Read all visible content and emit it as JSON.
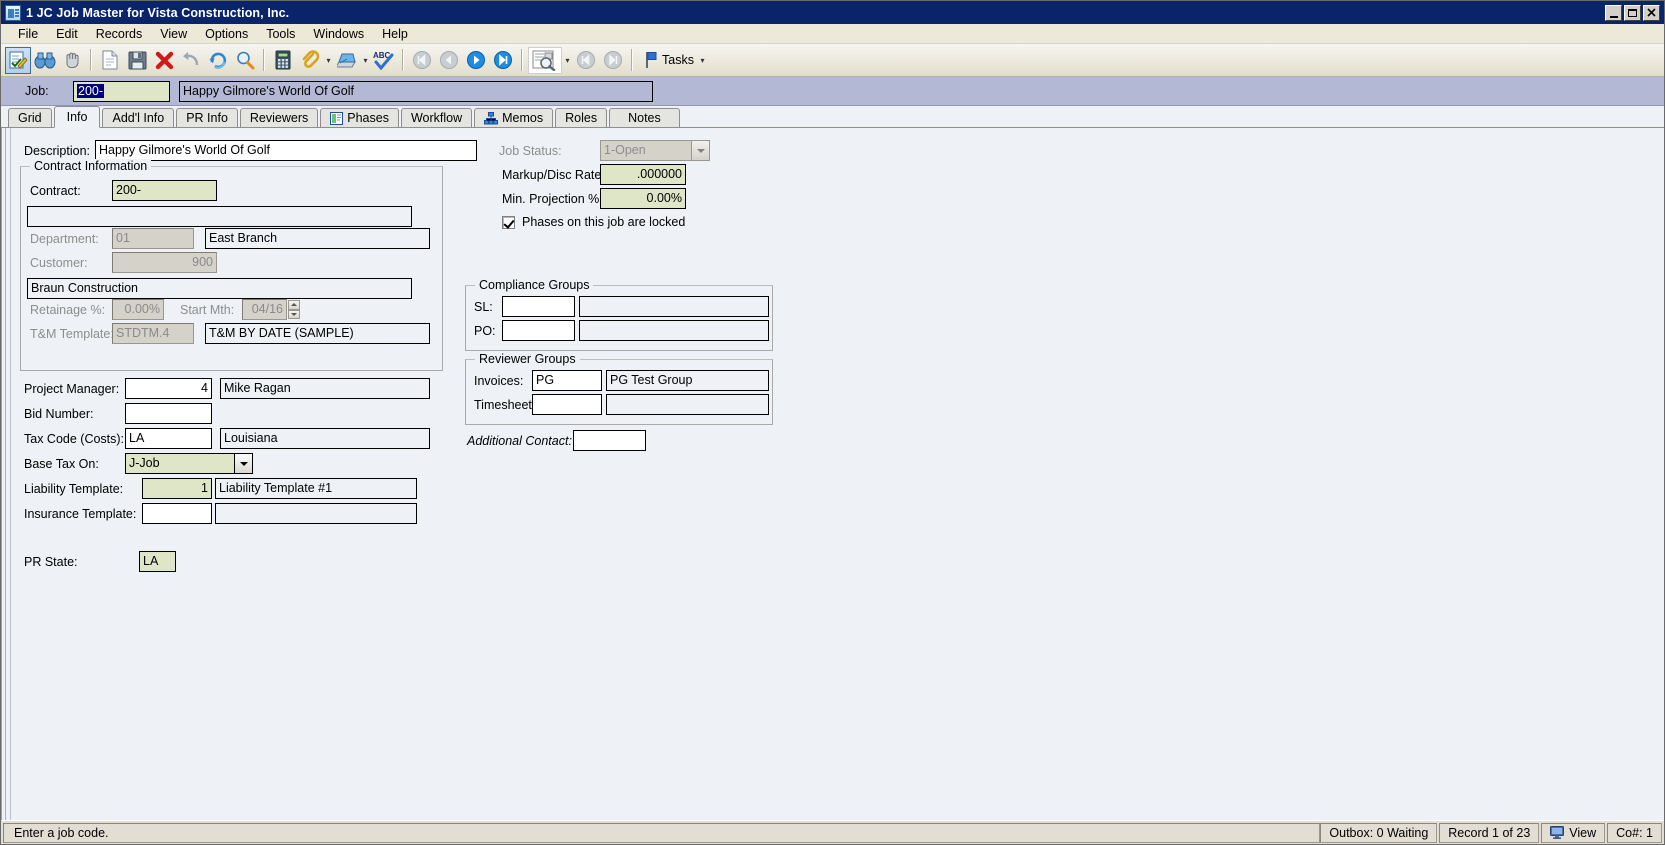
{
  "window": {
    "title": "1 JC Job Master for Vista Construction, Inc.",
    "icon": "app-window-icon",
    "minimize": "_",
    "maximize": "❐",
    "close": "✕"
  },
  "menubar": {
    "items": [
      "File",
      "Edit",
      "Records",
      "View",
      "Options",
      "Tools",
      "Windows",
      "Help"
    ]
  },
  "toolbar": {
    "buttons": [
      {
        "name": "edit-mode-icon",
        "glyph": "pencil-form"
      },
      {
        "name": "binoculars-icon",
        "glyph": "binoculars"
      },
      {
        "name": "grab-hand-icon",
        "glyph": "hand"
      },
      {
        "name": "new-record-icon",
        "glyph": "document"
      },
      {
        "name": "save-icon",
        "glyph": "floppy"
      },
      {
        "name": "delete-icon",
        "glyph": "red-x"
      },
      {
        "name": "undo-icon",
        "glyph": "undo-arrow"
      },
      {
        "name": "refresh-icon",
        "glyph": "refresh"
      },
      {
        "name": "find-icon",
        "glyph": "magnifier"
      },
      {
        "name": "calculator-icon",
        "glyph": "calculator"
      },
      {
        "name": "attachment-icon",
        "glyph": "paperclip"
      },
      {
        "name": "print-icon",
        "glyph": "printer"
      },
      {
        "name": "spellcheck-icon",
        "glyph": "abc-check"
      },
      {
        "name": "first-record-icon",
        "glyph": "first"
      },
      {
        "name": "previous-record-icon",
        "glyph": "prev"
      },
      {
        "name": "next-record-icon",
        "glyph": "next"
      },
      {
        "name": "last-record-icon",
        "glyph": "last"
      },
      {
        "name": "preview-icon",
        "glyph": "page-magnifier"
      },
      {
        "name": "prev-page-icon",
        "glyph": "first-dim"
      },
      {
        "name": "next-page-icon",
        "glyph": "last-dim"
      }
    ],
    "tasks_label": "Tasks",
    "tasks_icon": "flag-icon"
  },
  "jobstrip": {
    "job_label": "Job:",
    "job_code": "200-",
    "job_code_selected": true,
    "job_description": "Happy Gilmore's World Of Golf"
  },
  "tabs": [
    {
      "label": "Grid",
      "icon": null,
      "active": false
    },
    {
      "label": "Info",
      "icon": null,
      "active": true
    },
    {
      "label": "Add'l Info",
      "icon": null,
      "active": false
    },
    {
      "label": "PR Info",
      "icon": null,
      "active": false
    },
    {
      "label": "Reviewers",
      "icon": null,
      "active": false
    },
    {
      "label": "Phases",
      "icon": "phases-icon",
      "active": false
    },
    {
      "label": "Workflow",
      "icon": null,
      "active": false
    },
    {
      "label": "Memos",
      "icon": "memos-icon",
      "active": false
    },
    {
      "label": "Roles",
      "icon": null,
      "active": false
    },
    {
      "label": "Notes",
      "icon": null,
      "active": false
    }
  ],
  "form": {
    "description_label": "Description:",
    "description_value": "Happy Gilmore's World Of Golf",
    "contract_group_title": "Contract Information",
    "contract_label": "Contract:",
    "contract_value": "200-",
    "contract_desc_value": "",
    "department_label": "Department:",
    "department_value": "01",
    "department_desc": "East Branch",
    "customer_label": "Customer:",
    "customer_value": "900",
    "customer_desc": "Braun Construction",
    "retainage_label": "Retainage %:",
    "retainage_value": "0.00%",
    "startmth_label": "Start Mth:",
    "startmth_value": "04/16",
    "tm_template_label": "T&M Template:",
    "tm_template_value": "STDTM.4",
    "tm_template_desc": "T&M BY DATE (SAMPLE)",
    "project_manager_label": "Project Manager:",
    "project_manager_value": "4",
    "project_manager_desc": "Mike Ragan",
    "bid_number_label": "Bid Number:",
    "bid_number_value": "",
    "tax_code_label": "Tax Code (Costs):",
    "tax_code_value": "LA",
    "tax_code_desc": "Louisiana",
    "base_tax_on_label": "Base Tax On:",
    "base_tax_on_value": "J-Job",
    "liability_template_label": "Liability Template:",
    "liability_template_value": "1",
    "liability_template_desc": "Liability Template #1",
    "insurance_template_label": "Insurance Template:",
    "insurance_template_value": "",
    "insurance_template_desc": "",
    "pr_state_label": "PR State:",
    "pr_state_value": "LA",
    "job_status_label": "Job Status:",
    "job_status_value": "1-Open",
    "markup_label": "Markup/Disc Rate:",
    "markup_value": ".000000",
    "min_projection_label": "Min. Projection %:",
    "min_projection_value": "0.00%",
    "phases_locked_label": "Phases on this job are locked",
    "phases_locked_checked": true,
    "compliance_group_title": "Compliance Groups",
    "compliance_sl_label": "SL:",
    "compliance_sl_value": "",
    "compliance_sl_desc": "",
    "compliance_po_label": "PO:",
    "compliance_po_value": "",
    "compliance_po_desc": "",
    "reviewer_group_title": "Reviewer Groups",
    "reviewer_invoices_label": "Invoices:",
    "reviewer_invoices_value": "PG",
    "reviewer_invoices_desc": "PG Test Group",
    "reviewer_timesheet_label": "Timesheet:",
    "reviewer_timesheet_value": "",
    "reviewer_timesheet_desc": "",
    "additional_contact_label": "Additional Contact:",
    "additional_contact_value": ""
  },
  "statusbar": {
    "message": "Enter a job code.",
    "outbox": "Outbox: 0 Waiting",
    "record": "Record 1 of 23",
    "view": "View",
    "view_icon": "monitor-icon",
    "company": "Co#: 1"
  },
  "colors": {
    "titlebar": "#0a246a",
    "required_field": "#dfe5c7",
    "readonly_field": "#d5d2ca",
    "job_strip": "#b3b9d4",
    "content_bg": "#eef1f5",
    "selection": "#000080"
  }
}
